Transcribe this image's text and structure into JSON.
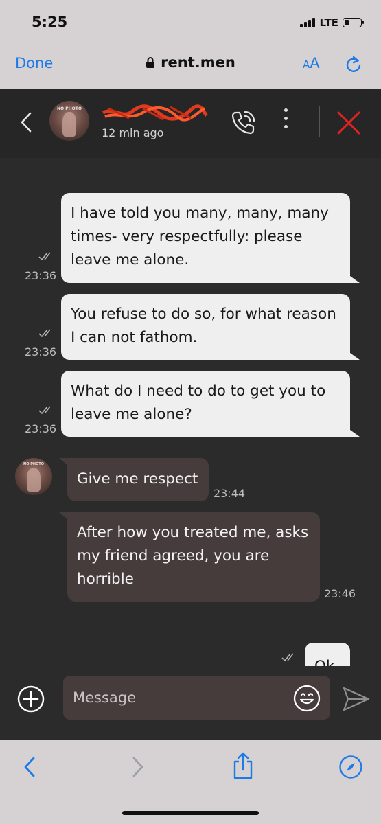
{
  "status_bar": {
    "time": "5:25",
    "network": "LTE"
  },
  "browser": {
    "done_label": "Done",
    "url": "rent.men",
    "aa_label_small": "A",
    "aa_label_large": "A"
  },
  "chat_header": {
    "last_seen": "12 min ago",
    "avatar_label": "NO PHOTO"
  },
  "messages": [
    {
      "direction": "out",
      "text": "I have told you many, many, many times- very respectfully: please leave me alone.",
      "time": "23:36"
    },
    {
      "direction": "out",
      "text": "You refuse to do so, for what reason I can not fathom.",
      "time": "23:36"
    },
    {
      "direction": "out",
      "text": "What do I need to do to get you to leave me alone?",
      "time": "23:36"
    },
    {
      "direction": "in",
      "text": "Give me respect",
      "time": "23:44"
    },
    {
      "direction": "in",
      "text": "After how you treated me, asks my friend agreed, you are horrible",
      "time": "23:46"
    },
    {
      "direction": "out",
      "text": "Ok",
      "time": ""
    }
  ],
  "composer": {
    "placeholder": "Message"
  },
  "colors": {
    "accent": "#1e7ae6",
    "close": "#e02424",
    "incoming_bubble": "#463c3c",
    "outgoing_bubble": "#efefef",
    "background": "#2b2b2b"
  },
  "icons": [
    "lock-icon",
    "reload-icon",
    "back-chevron-icon",
    "phone-call-icon",
    "more-vertical-icon",
    "close-icon",
    "read-ticks-icon",
    "add-icon",
    "emoji-icon",
    "send-icon",
    "browser-back-icon",
    "browser-forward-icon",
    "share-icon",
    "compass-icon"
  ]
}
